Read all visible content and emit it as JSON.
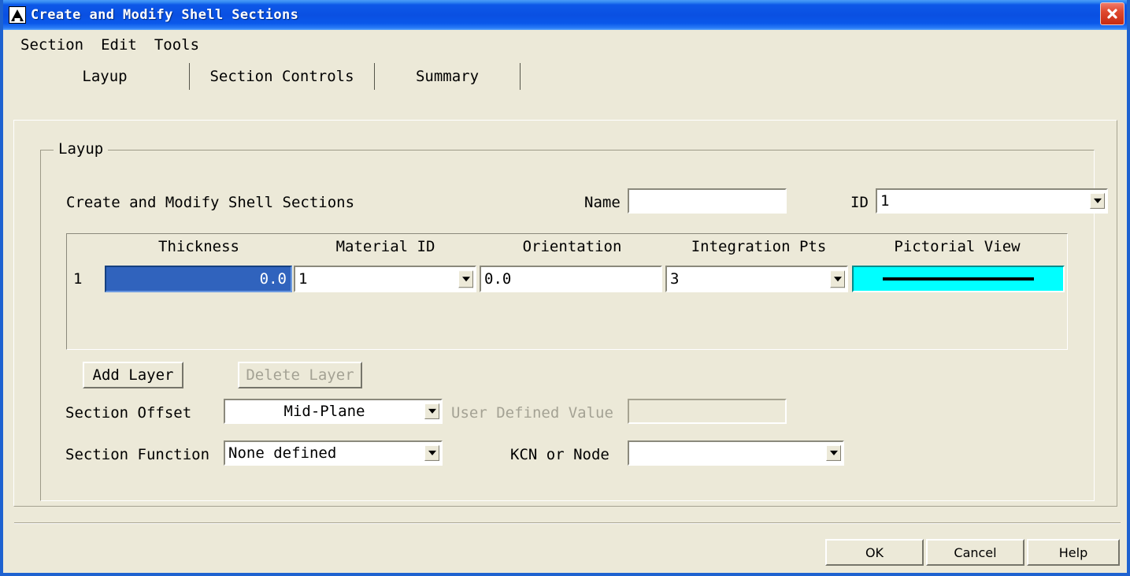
{
  "window": {
    "title": "Create and Modify Shell Sections",
    "app_icon": "ansys-a-icon",
    "close_icon": "close-icon"
  },
  "menubar": {
    "items": [
      {
        "label": "Section"
      },
      {
        "label": "Edit"
      },
      {
        "label": "Tools"
      }
    ]
  },
  "tabs": [
    {
      "label": "Layup",
      "selected": true
    },
    {
      "label": "Section Controls",
      "selected": false
    },
    {
      "label": "Summary",
      "selected": false
    }
  ],
  "layup": {
    "group_title": "Layup",
    "description": "Create and Modify Shell Sections",
    "name_label": "Name",
    "name_value": "",
    "id_label": "ID",
    "id_value": "1",
    "table": {
      "columns": [
        "Thickness",
        "Material ID",
        "Orientation",
        "Integration Pts",
        "Pictorial View"
      ],
      "rows": [
        {
          "index": "1",
          "thickness": "0.0",
          "material_id": "1",
          "orientation": "0.0",
          "integration_pts": "3",
          "pictorial_view": "layer-line"
        }
      ]
    },
    "add_layer_label": "Add Layer",
    "delete_layer_label": "Delete Layer",
    "section_offset_label": "Section Offset",
    "section_offset_value": "Mid-Plane",
    "user_defined_value_label": "User Defined Value",
    "user_defined_value": "",
    "section_function_label": "Section Function",
    "section_function_value": "None defined",
    "kcn_label": "KCN or Node",
    "kcn_value": ""
  },
  "footer": {
    "ok_label": "OK",
    "cancel_label": "Cancel",
    "help_label": "Help"
  },
  "colors": {
    "title_blue": "#0a50e2",
    "frame_blue": "#1e62d0",
    "dialog_face": "#ece9d8",
    "selection_blue": "#3063bd",
    "pictorial_cyan": "#00ffff",
    "close_red": "#c62b12",
    "disabled_text": "#a4a294"
  }
}
